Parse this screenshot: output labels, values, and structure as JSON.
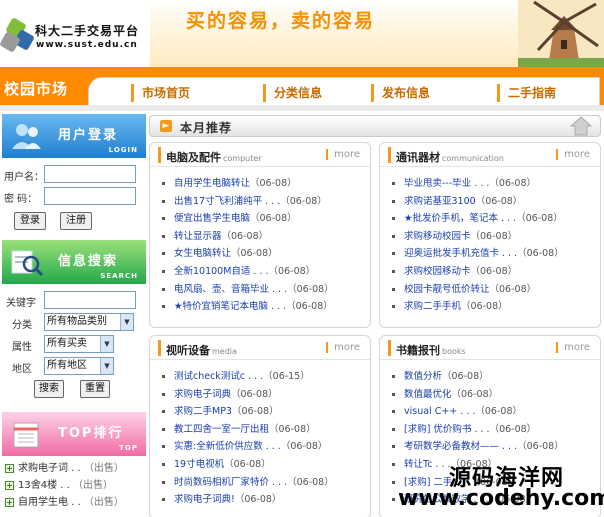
{
  "header": {
    "site_name": "科大二手交易平台",
    "site_url": "www.sust.edu.cn",
    "slogan": "买的容易，卖的容易"
  },
  "nav": {
    "market_label": "校园市场",
    "tabs": [
      "市场首页",
      "分类信息",
      "发布信息",
      "二手指南"
    ]
  },
  "login": {
    "title": "用户登录",
    "subtitle": "LOGIN",
    "username_label": "用户名：",
    "password_label": "密  码：",
    "login_button": "登录",
    "register_button": "注册"
  },
  "search": {
    "title": "信息搜索",
    "subtitle": "SEARCH",
    "keyword_label": "关键字",
    "category_label": "分类",
    "category_value": "所有物品类别",
    "attribute_label": "属性",
    "attribute_value": "所有买卖",
    "region_label": "地区",
    "region_value": "所有地区",
    "search_button": "搜索",
    "reset_button": "重置"
  },
  "top": {
    "title": "TOP排行",
    "subtitle": "TOP",
    "items": [
      {
        "text": "求购电子词 . .",
        "status": "（出售）"
      },
      {
        "text": "13舍4楼 . .",
        "status": "（出售）"
      },
      {
        "text": "自用学生电 . .",
        "status": "（出售）"
      }
    ]
  },
  "featured": {
    "title": "本月推荐"
  },
  "panels": [
    {
      "title": "电脑及配件",
      "en": "computer",
      "more": "more",
      "items": [
        {
          "text": "自用学生电脑转让",
          "date": "（06-08）"
        },
        {
          "text": "出售17寸飞利浦纯平 . . .",
          "date": "（06-08）"
        },
        {
          "text": "便宜出售学生电脑",
          "date": "（06-08）"
        },
        {
          "text": "转让显示器",
          "date": "（06-08）"
        },
        {
          "text": "女生电脑转让",
          "date": "（06-08）"
        },
        {
          "text": "全新10100M自适 . . .",
          "date": "（06-08）"
        },
        {
          "text": "电风扇、壶、音箱毕业 . . .",
          "date": "（06-08）"
        },
        {
          "text": "★特价宜销笔记本电脑 . . .",
          "date": "（06-08）"
        }
      ]
    },
    {
      "title": "通讯器材",
      "en": "communication",
      "more": "more",
      "items": [
        {
          "text": "毕业甩卖---毕业 . . .",
          "date": "（06-08）"
        },
        {
          "text": "求购诺基亚3100",
          "date": "（06-08）"
        },
        {
          "text": "★批发价手机，笔记本 . . .",
          "date": "（06-08）"
        },
        {
          "text": "求购移动校园卡",
          "date": "（06-08）"
        },
        {
          "text": "迎奥运批发手机充值卡 . . .",
          "date": "（06-08）"
        },
        {
          "text": "求购校园移动卡",
          "date": "（06-08）"
        },
        {
          "text": "校园卡靓号低价转让",
          "date": "（06-08）"
        },
        {
          "text": "求购二手手机",
          "date": "（06-08）"
        }
      ]
    },
    {
      "title": "视听设备",
      "en": "media",
      "more": "more",
      "items": [
        {
          "text": "测试check测试c . . .",
          "date": "（06-15）"
        },
        {
          "text": "求购电子词典",
          "date": "（06-08）"
        },
        {
          "text": "求购二手MP3",
          "date": "（06-08）"
        },
        {
          "text": "教工四舍一室一厅出租",
          "date": "（06-08）"
        },
        {
          "text": "实惠:全新低价供应数 . . .",
          "date": "（06-08）"
        },
        {
          "text": "19寸电视机",
          "date": "（06-08）"
        },
        {
          "text": "时尚数码相机厂家特价 . . .",
          "date": "（06-08）"
        },
        {
          "text": "求购电子词典!",
          "date": "（06-08）"
        }
      ]
    },
    {
      "title": "书籍报刊",
      "en": "books",
      "more": "more",
      "items": [
        {
          "text": "数值分析",
          "date": "（06-08）"
        },
        {
          "text": "数值最优化",
          "date": "（06-08）"
        },
        {
          "text": "visual C++ . . .",
          "date": "（06-08）"
        },
        {
          "text": "[求购] 优价购书 . . .",
          "date": "（06-08）"
        },
        {
          "text": "考研数学必备教材—— . . .",
          "date": "（06-08）"
        },
        {
          "text": "转让Tc . . .",
          "date": "（06-08）"
        },
        {
          "text": "[求购] 二手 . . .",
          "date": "（06-08）"
        },
        {
          "text": "研究生公共数学 . . .",
          "date": "（06-08）"
        }
      ]
    }
  ],
  "watermark": {
    "line1": "源码海洋网",
    "line2": "www.codehy.com"
  },
  "colors": {
    "accent_orange": "#ff8a00",
    "link_blue": "#1a3fb0",
    "login_blue": "#2f8fd8",
    "search_green": "#2bb44a",
    "top_pink": "#f06aa4"
  }
}
